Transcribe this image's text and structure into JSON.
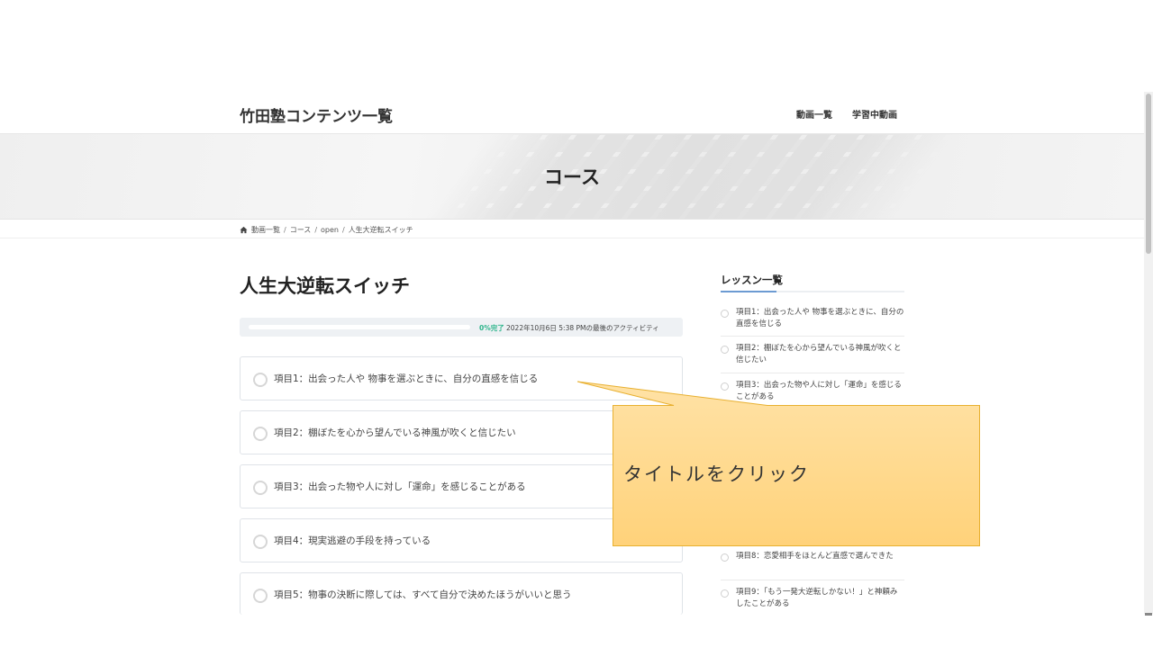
{
  "header": {
    "site_title": "竹田塾コンテンツ一覧",
    "nav": [
      "動画一覧",
      "学習中動画"
    ]
  },
  "hero": {
    "title": "コース"
  },
  "breadcrumb": {
    "home_icon": "home-icon",
    "items": [
      "動画一覧",
      "コース",
      "open",
      "人生大逆転スイッチ"
    ],
    "separator": "/"
  },
  "course": {
    "title": "人生大逆転スイッチ",
    "progress": {
      "percent": 0,
      "percent_label": "0%完了",
      "activity": "2022年10月6日 5:38 PMの最後のアクティビティ",
      "color": "#2fb58c"
    },
    "lessons": [
      "項目1：出会った人や 物事を選ぶときに、自分の直感を信じる",
      "項目2：棚ぼたを心から望んでいる神風が吹くと信じたい",
      "項目3：出会った物や人に対し「運命」を感じることがある",
      "項目4：現実逃避の手段を持っている",
      "項目5：物事の決断に際しては、すべて自分で決めたほうがいいと思う"
    ]
  },
  "sidebar": {
    "heading": "レッスン一覧",
    "accent": "#6c9bd2",
    "items": [
      "項目1：出会った人や 物事を選ぶときに、自分の直感を信じる",
      "項目2：棚ぼたを心から望んでいる神風が吹くと信じたい",
      "項目3：出会った物や人に対し「運命」を感じることがある",
      "項目8：恋愛相手をほとんど直感で選んできた",
      "項目9：「もう一発大逆転しかない！」と神頼みしたことがある"
    ]
  },
  "callout": {
    "text": "タイトルをクリック",
    "fill": "#ffd98a",
    "border": "#e8b030"
  }
}
